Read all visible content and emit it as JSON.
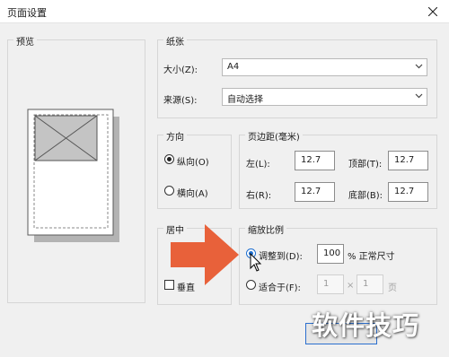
{
  "window": {
    "title": "页面设置"
  },
  "preview": {
    "label": "预览"
  },
  "paper": {
    "label": "纸张",
    "size_label": "大小(Z):",
    "size_value": "A4",
    "source_label": "来源(S):",
    "source_value": "自动选择"
  },
  "orientation": {
    "label": "方向",
    "portrait": "纵向(O)",
    "landscape": "横向(A)"
  },
  "margins": {
    "label": "页边距(毫米)",
    "left_label": "左(L):",
    "left_value": "12.7",
    "top_label": "顶部(T):",
    "top_value": "12.7",
    "right_label": "右(R):",
    "right_value": "12.7",
    "bottom_label": "底部(B):",
    "bottom_value": "12.7"
  },
  "center": {
    "label": "居中",
    "vertical_partial": "垂直"
  },
  "scaling": {
    "label": "缩放比例",
    "adjust_label": "调整到(D):",
    "adjust_value": "100",
    "adjust_suffix": "% 正常尺寸",
    "fit_label": "适合于(F):",
    "fit_wide": "1",
    "times": "×",
    "fit_tall": "1",
    "pages_unit": "页"
  },
  "watermark": "软件技巧",
  "colors": {
    "arrow": "#e8613a",
    "radio_accent": "#1e6fd0"
  }
}
